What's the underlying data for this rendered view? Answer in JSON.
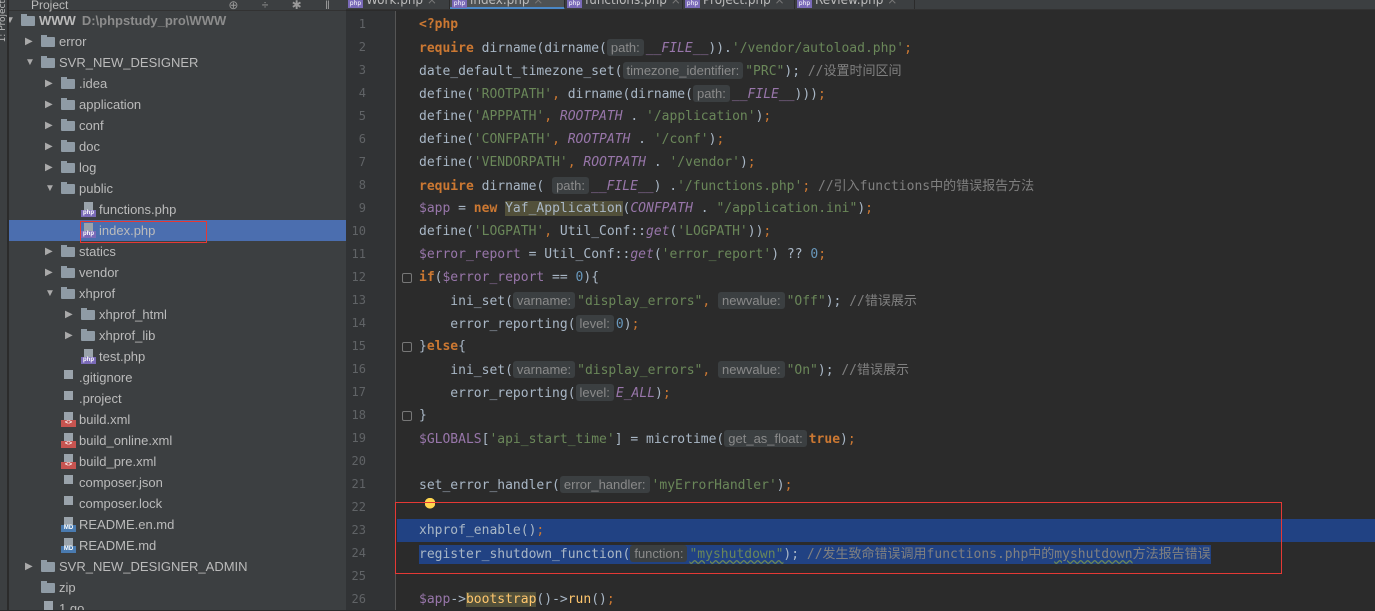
{
  "side_strip": {
    "label": "1: Project"
  },
  "project_panel": {
    "title": "Project"
  },
  "tree": [
    {
      "label": "WWW",
      "path": "D:\\phpstudy_pro\\WWW",
      "level": 0,
      "type": "folder",
      "arrow": "open"
    },
    {
      "label": "error",
      "level": 1,
      "type": "folder",
      "arrow": "closed"
    },
    {
      "label": "SVR_NEW_DESIGNER",
      "level": 1,
      "type": "folder",
      "arrow": "open"
    },
    {
      "label": ".idea",
      "level": 2,
      "type": "folder",
      "arrow": "closed"
    },
    {
      "label": "application",
      "level": 2,
      "type": "folder",
      "arrow": "closed"
    },
    {
      "label": "conf",
      "level": 2,
      "type": "folder",
      "arrow": "closed"
    },
    {
      "label": "doc",
      "level": 2,
      "type": "folder",
      "arrow": "closed"
    },
    {
      "label": "log",
      "level": 2,
      "type": "folder",
      "arrow": "closed"
    },
    {
      "label": "public",
      "level": 2,
      "type": "folder",
      "arrow": "open"
    },
    {
      "label": "functions.php",
      "level": 3,
      "type": "php"
    },
    {
      "label": "index.php",
      "level": 3,
      "type": "php",
      "selected": true
    },
    {
      "label": "statics",
      "level": 2,
      "type": "folder",
      "arrow": "closed"
    },
    {
      "label": "vendor",
      "level": 2,
      "type": "folder",
      "arrow": "closed"
    },
    {
      "label": "xhprof",
      "level": 2,
      "type": "folder",
      "arrow": "open"
    },
    {
      "label": "xhprof_html",
      "level": 3,
      "type": "folder",
      "arrow": "closed"
    },
    {
      "label": "xhprof_lib",
      "level": 3,
      "type": "folder",
      "arrow": "closed"
    },
    {
      "label": "test.php",
      "level": 3,
      "type": "php"
    },
    {
      "label": ".gitignore",
      "level": 2,
      "type": "text"
    },
    {
      "label": ".project",
      "level": 2,
      "type": "text"
    },
    {
      "label": "build.xml",
      "level": 2,
      "type": "xml"
    },
    {
      "label": "build_online.xml",
      "level": 2,
      "type": "xml"
    },
    {
      "label": "build_pre.xml",
      "level": 2,
      "type": "xml"
    },
    {
      "label": "composer.json",
      "level": 2,
      "type": "text"
    },
    {
      "label": "composer.lock",
      "level": 2,
      "type": "text"
    },
    {
      "label": "README.en.md",
      "level": 2,
      "type": "md"
    },
    {
      "label": "README.md",
      "level": 2,
      "type": "md"
    },
    {
      "label": "SVR_NEW_DESIGNER_ADMIN",
      "level": 1,
      "type": "folder",
      "arrow": "closed"
    },
    {
      "label": "zip",
      "level": 1,
      "type": "folder",
      "arrow": "none"
    },
    {
      "label": "1.go",
      "level": 1,
      "type": "text"
    }
  ],
  "tabs": [
    {
      "label": "Work.php"
    },
    {
      "label": "index.php",
      "active": true
    },
    {
      "label": "functions.php"
    },
    {
      "label": "Project.php"
    },
    {
      "label": "Review.php"
    }
  ],
  "code": [
    [
      [
        "k",
        "<?php"
      ]
    ],
    [
      [
        "k",
        "require "
      ],
      [
        "",
        "dirname(dirname("
      ],
      [
        "hint",
        "path:"
      ],
      [
        "ci",
        "__FILE__"
      ],
      [
        "",
        "))."
      ],
      [
        "s",
        "'/vendor/autoload.php'"
      ],
      [
        "p",
        ";"
      ]
    ],
    [
      [
        "",
        "date_default_timezone_set("
      ],
      [
        "hint",
        "timezone_identifier:"
      ],
      [
        "s",
        "\"PRC\""
      ],
      [
        "",
        "); "
      ],
      [
        "c",
        "//设置时间区间"
      ]
    ],
    [
      [
        "",
        "define("
      ],
      [
        "s",
        "'ROOTPATH'"
      ],
      [
        "p",
        ", "
      ],
      [
        "",
        "dirname(dirname("
      ],
      [
        "hint",
        "path:"
      ],
      [
        "ci",
        "__FILE__"
      ],
      [
        "",
        ")))"
      ],
      [
        "p",
        ";"
      ]
    ],
    [
      [
        "",
        "define("
      ],
      [
        "s",
        "'APPPATH'"
      ],
      [
        "p",
        ", "
      ],
      [
        "ci",
        "ROOTPATH"
      ],
      [
        "",
        " . "
      ],
      [
        "s",
        "'/application'"
      ],
      [
        "",
        ")"
      ],
      [
        "p",
        ";"
      ]
    ],
    [
      [
        "",
        "define("
      ],
      [
        "s",
        "'CONFPATH'"
      ],
      [
        "p",
        ", "
      ],
      [
        "ci",
        "ROOTPATH"
      ],
      [
        "",
        " . "
      ],
      [
        "s",
        "'/conf'"
      ],
      [
        "",
        ")"
      ],
      [
        "p",
        ";"
      ]
    ],
    [
      [
        "",
        "define("
      ],
      [
        "s",
        "'VENDORPATH'"
      ],
      [
        "p",
        ", "
      ],
      [
        "ci",
        "ROOTPATH"
      ],
      [
        "",
        " . "
      ],
      [
        "s",
        "'/vendor'"
      ],
      [
        "",
        ")"
      ],
      [
        "p",
        ";"
      ]
    ],
    [
      [
        "k",
        "require "
      ],
      [
        "",
        "dirname( "
      ],
      [
        "hint",
        "path:"
      ],
      [
        "ci",
        "__FILE__"
      ],
      [
        "",
        ") ."
      ],
      [
        "s",
        "'/functions.php'"
      ],
      [
        "p",
        "; "
      ],
      [
        "c",
        "//引入functions中的错误报告方法"
      ]
    ],
    [
      [
        "v",
        "$app"
      ],
      [
        "",
        " = "
      ],
      [
        "k",
        "new "
      ],
      [
        "m",
        "Yaf_Application"
      ],
      [
        "",
        "("
      ],
      [
        "ci",
        "CONFPATH"
      ],
      [
        "",
        " . "
      ],
      [
        "s",
        "\"/application.ini\""
      ],
      [
        "",
        ")"
      ],
      [
        "p",
        ";"
      ]
    ],
    [
      [
        "",
        "define("
      ],
      [
        "s",
        "'LOGPATH'"
      ],
      [
        "p",
        ", "
      ],
      [
        "",
        "Util_Conf::"
      ],
      [
        "ci",
        "get"
      ],
      [
        "",
        "("
      ],
      [
        "s",
        "'LOGPATH'"
      ],
      [
        "",
        "))"
      ],
      [
        "p",
        ";"
      ]
    ],
    [
      [
        "v",
        "$error_report"
      ],
      [
        "",
        " = Util_Conf::"
      ],
      [
        "ci",
        "get"
      ],
      [
        "",
        "("
      ],
      [
        "s",
        "'error_report'"
      ],
      [
        "",
        ") ?? "
      ],
      [
        "n",
        "0"
      ],
      [
        "p",
        ";"
      ]
    ],
    [
      [
        "k",
        "if"
      ],
      [
        "",
        "("
      ],
      [
        "v",
        "$error_report"
      ],
      [
        "",
        " == "
      ],
      [
        "n",
        "0"
      ],
      [
        "",
        "){"
      ]
    ],
    [
      [
        "",
        "    ini_set("
      ],
      [
        "hint",
        "varname:"
      ],
      [
        "s",
        "\"display_errors\""
      ],
      [
        "p",
        ", "
      ],
      [
        "hint",
        "newvalue:"
      ],
      [
        "s",
        "\"Off\""
      ],
      [
        "",
        "); "
      ],
      [
        "c",
        "//错误展示"
      ]
    ],
    [
      [
        "",
        "    error_reporting("
      ],
      [
        "hint",
        "level:"
      ],
      [
        "n",
        "0"
      ],
      [
        "",
        ")"
      ],
      [
        "p",
        ";"
      ]
    ],
    [
      [
        "",
        "}"
      ],
      [
        "k",
        "else"
      ],
      [
        "",
        "{"
      ]
    ],
    [
      [
        "",
        "    ini_set("
      ],
      [
        "hint",
        "varname:"
      ],
      [
        "s",
        "\"display_errors\""
      ],
      [
        "p",
        ", "
      ],
      [
        "hint",
        "newvalue:"
      ],
      [
        "s",
        "\"On\""
      ],
      [
        "",
        "); "
      ],
      [
        "c",
        "//错误展示"
      ]
    ],
    [
      [
        "",
        "    error_reporting("
      ],
      [
        "hint",
        "level:"
      ],
      [
        "ci",
        "E_ALL"
      ],
      [
        "",
        ")"
      ],
      [
        "p",
        ";"
      ]
    ],
    [
      [
        "",
        "}"
      ]
    ],
    [
      [
        "v",
        "$GLOBALS"
      ],
      [
        "",
        "["
      ],
      [
        "s",
        "'api_start_time'"
      ],
      [
        "",
        "] = microtime("
      ],
      [
        "hint",
        "get_as_float:"
      ],
      [
        "k",
        "true"
      ],
      [
        "",
        ")"
      ],
      [
        "p",
        ";"
      ]
    ],
    [],
    [
      [
        "",
        "set_error_handler("
      ],
      [
        "hint",
        "error_handler:"
      ],
      [
        "s",
        "'myErrorHandler'"
      ],
      [
        "",
        ")"
      ],
      [
        "p",
        ";"
      ]
    ],
    [],
    [
      [
        "",
        "xhprof_enable()"
      ],
      [
        "p",
        ";"
      ]
    ],
    [
      [
        "",
        "register_shutdown_function("
      ],
      [
        "hint",
        "function:"
      ],
      [
        "s u",
        "\"myshutdown\""
      ],
      [
        "",
        "); "
      ],
      [
        "c",
        "//发生致命错误调用functions.php中的"
      ],
      [
        "c u",
        "myshutdown"
      ],
      [
        "c",
        "方法报告错误"
      ]
    ],
    [],
    [
      [
        "v",
        "$app"
      ],
      [
        "",
        "->"
      ],
      [
        "f m",
        "bootstrap"
      ],
      [
        "",
        "()->"
      ],
      [
        "f",
        "run"
      ],
      [
        "",
        "()"
      ],
      [
        "p",
        ";"
      ]
    ]
  ],
  "highlighted_lines": [
    23,
    24
  ]
}
